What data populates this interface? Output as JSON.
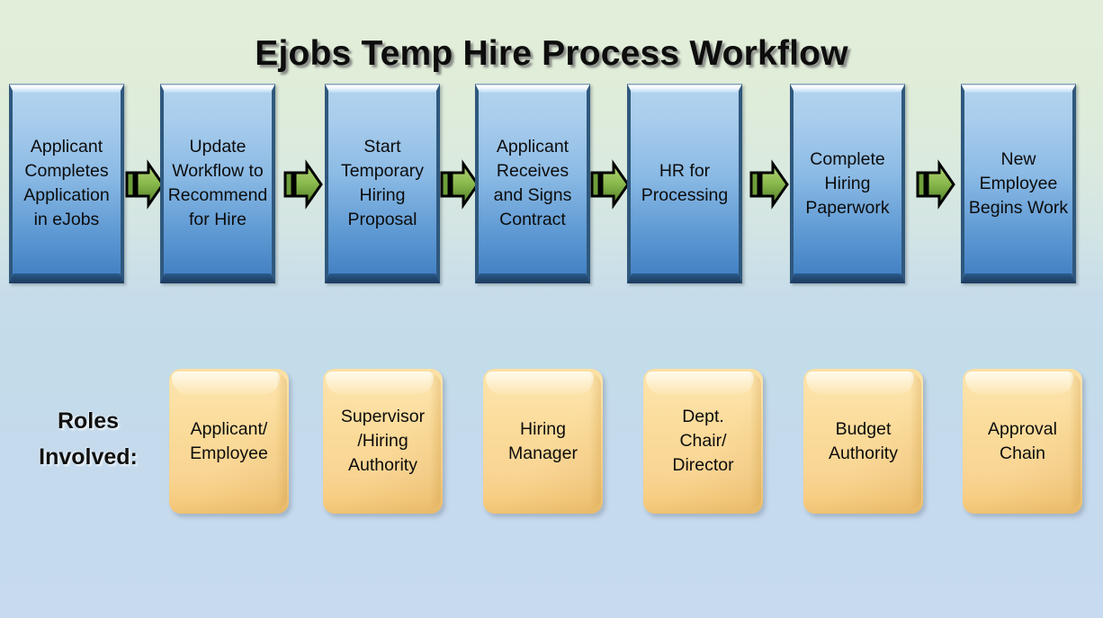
{
  "title": "Ejobs Temp Hire Process Workflow",
  "background": {
    "top_color": "#e0edd8",
    "bottom_color": "#c7daf0"
  },
  "process": {
    "box_fill_top": "#a9cdec",
    "box_fill_bottom": "#3e7cc0",
    "arrow_color": "#7bb03f",
    "steps": [
      {
        "label": "Applicant\nCompletes\nApplication\nin eJobs"
      },
      {
        "label": "Update\nWorkflow to\nRecommend\nfor Hire"
      },
      {
        "label": "Start\nTemporary\nHiring\nProposal"
      },
      {
        "label": "Applicant\nReceives\nand Signs\nContract"
      },
      {
        "label": "HR for\nProcessing"
      },
      {
        "label": "Complete\nHiring\nPaperwork"
      },
      {
        "label": "New\nEmployee\nBegins Work"
      }
    ],
    "connectors": [
      {
        "name": "arrow-1"
      },
      {
        "name": "arrow-2"
      },
      {
        "name": "arrow-3"
      },
      {
        "name": "arrow-4"
      },
      {
        "name": "arrow-5"
      },
      {
        "name": "arrow-6"
      }
    ]
  },
  "roles": {
    "heading": "Roles\nInvolved:",
    "box_fill": "#fbdb99",
    "items": [
      {
        "label": "Applicant/\nEmployee"
      },
      {
        "label": "Supervisor\n/Hiring\nAuthority"
      },
      {
        "label": "Hiring\nManager"
      },
      {
        "label": "Dept.\nChair/\nDirector"
      },
      {
        "label": "Budget\nAuthority"
      },
      {
        "label": "Approval\nChain"
      }
    ]
  }
}
